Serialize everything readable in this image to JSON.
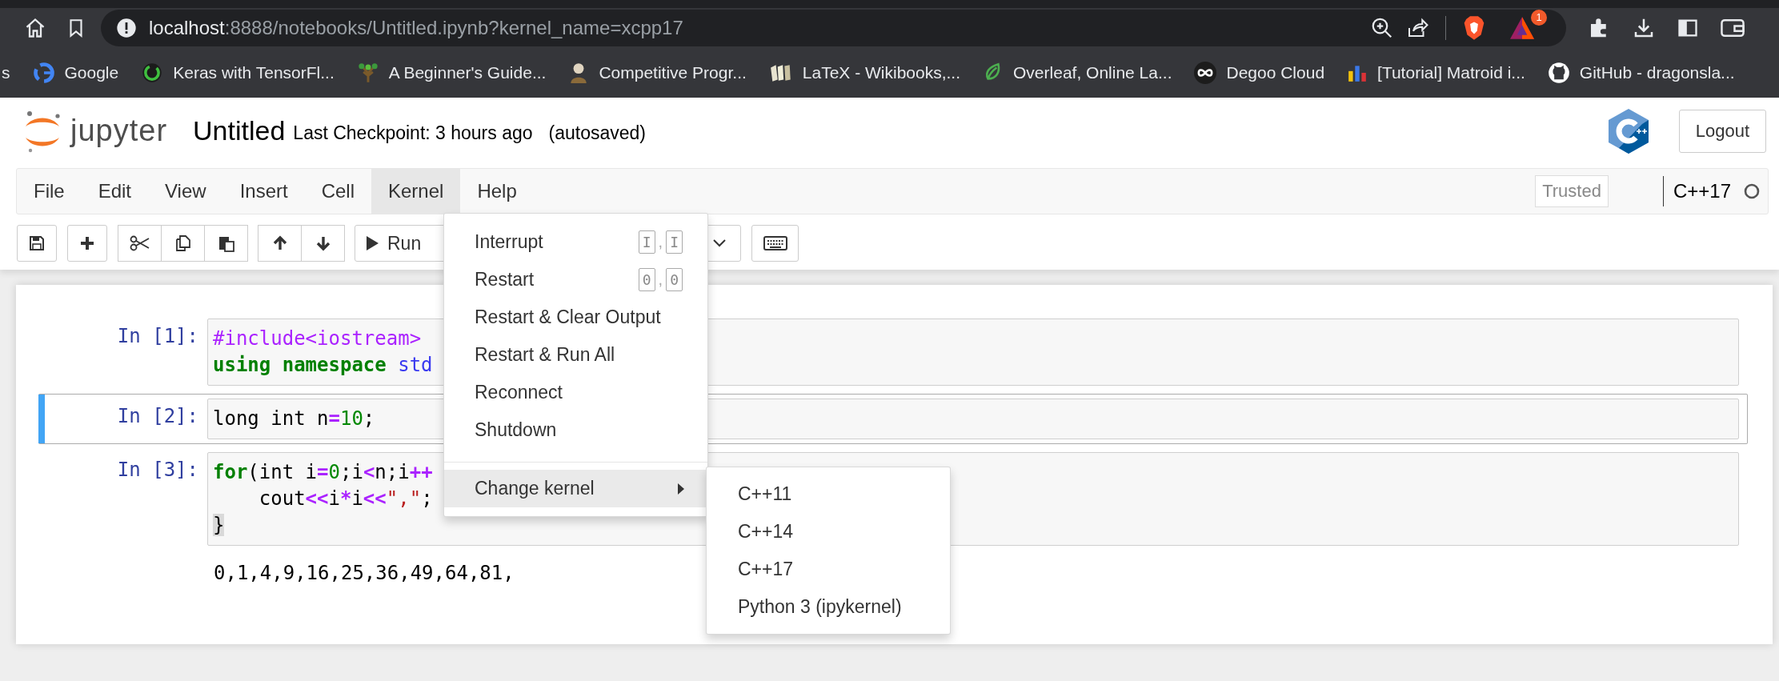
{
  "browser": {
    "address": {
      "host": "localhost",
      "path": ":8888/notebooks/Untitled.ipynb?kernel_name=xcpp17"
    },
    "badge": "1",
    "bookmarks": [
      {
        "kind": "text",
        "label": "s"
      },
      {
        "kind": "google",
        "label": "Google"
      },
      {
        "kind": "ring",
        "label": "Keras with TensorFl..."
      },
      {
        "kind": "tree",
        "label": "A Beginner's Guide..."
      },
      {
        "kind": "figure",
        "label": "Competitive Progr..."
      },
      {
        "kind": "books",
        "label": "LaTeX - Wikibooks,..."
      },
      {
        "kind": "leaf",
        "label": "Overleaf, Online La..."
      },
      {
        "kind": "infinity",
        "label": "Degoo Cloud"
      },
      {
        "kind": "bars",
        "label": "[Tutorial] Matroid i..."
      },
      {
        "kind": "cat",
        "label": "GitHub - dragonsla..."
      }
    ]
  },
  "app_name": "jupyter",
  "notebook": {
    "name": "Untitled",
    "checkpoint": "Last Checkpoint: 3 hours ago",
    "autosave": "(autosaved)"
  },
  "logout": "Logout",
  "menubar": [
    {
      "label": "File",
      "selected": false
    },
    {
      "label": "Edit",
      "selected": false
    },
    {
      "label": "View",
      "selected": false
    },
    {
      "label": "Insert",
      "selected": false
    },
    {
      "label": "Cell",
      "selected": false
    },
    {
      "label": "Kernel",
      "selected": true
    },
    {
      "label": "Help",
      "selected": false
    }
  ],
  "trusted": "Trusted",
  "kernel": {
    "name": "C++17",
    "busy": false
  },
  "toolbar": {
    "run": "Run"
  },
  "kernel_menu": [
    {
      "kind": "item",
      "label": "Interrupt",
      "keys": [
        "I",
        "I"
      ],
      "separator": ",",
      "selected": false
    },
    {
      "kind": "item",
      "label": "Restart",
      "keys": [
        "0",
        "0"
      ],
      "separator": ",",
      "selected": false
    },
    {
      "kind": "item",
      "label": "Restart & Clear Output",
      "selected": false
    },
    {
      "kind": "item",
      "label": "Restart & Run All",
      "selected": false
    },
    {
      "kind": "item",
      "label": "Reconnect",
      "selected": false
    },
    {
      "kind": "item",
      "label": "Shutdown",
      "selected": false
    },
    {
      "kind": "divider"
    },
    {
      "kind": "submenu",
      "label": "Change kernel",
      "selected": true
    }
  ],
  "kernel_submenu": [
    {
      "label": "C++11",
      "selected": false
    },
    {
      "label": "C++14",
      "selected": false
    },
    {
      "label": "C++17",
      "selected": false
    },
    {
      "label": "Python 3 (ipykernel)",
      "selected": false
    }
  ],
  "cells": [
    {
      "prompt": "In [1]:",
      "selected": false,
      "lines": [
        [
          {
            "kind": "meta",
            "text": "#include<iostream>"
          }
        ],
        [
          {
            "kind": "keyword",
            "text": "using namespace "
          },
          {
            "kind": "builtin",
            "text": "std"
          }
        ]
      ]
    },
    {
      "prompt": "In [2]:",
      "selected": true,
      "lines": [
        [
          {
            "kind": "plain",
            "text": "long int n"
          },
          {
            "kind": "operator",
            "text": "="
          },
          {
            "kind": "number",
            "text": "10"
          },
          {
            "kind": "plain",
            "text": ";"
          }
        ]
      ]
    },
    {
      "prompt": "In [3]:",
      "selected": false,
      "lines": [
        [
          {
            "kind": "keyword",
            "text": "for"
          },
          {
            "kind": "plain",
            "text": "(int i"
          },
          {
            "kind": "operator",
            "text": "="
          },
          {
            "kind": "number",
            "text": "0"
          },
          {
            "kind": "plain",
            "text": ";i"
          },
          {
            "kind": "operator",
            "text": "<"
          },
          {
            "kind": "plain",
            "text": "n;i"
          },
          {
            "kind": "operator",
            "text": "++"
          }
        ],
        [
          {
            "kind": "plain",
            "text": "    cout"
          },
          {
            "kind": "operator",
            "text": "<<"
          },
          {
            "kind": "plain",
            "text": "i"
          },
          {
            "kind": "operator",
            "text": "*"
          },
          {
            "kind": "plain",
            "text": "i"
          },
          {
            "kind": "operator",
            "text": "<<"
          },
          {
            "kind": "string",
            "text": "\",\""
          },
          {
            "kind": "plain",
            "text": ";"
          }
        ],
        [
          {
            "kind": "bracket",
            "text": "}"
          }
        ]
      ],
      "output": "0,1,4,9,16,25,36,49,64,81,"
    }
  ]
}
